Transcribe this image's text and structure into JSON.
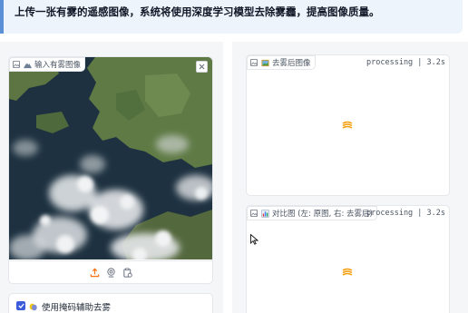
{
  "banner": {
    "text": "上传一张有雾的遥感图像，系统将使用深度学习模型去除雾霾，提高图像质量。"
  },
  "input_panel": {
    "label": "输入有雾图像",
    "label_icon": "mountain-snow-emoji",
    "tools": [
      "upload-icon",
      "webcam-icon",
      "clipboard-icon"
    ]
  },
  "output_panel": {
    "label": "去雾后图像",
    "label_icon": "framed-picture-emoji",
    "status": "processing | 3.2s"
  },
  "compare_panel": {
    "label": "对比图 (左: 原图, 右: 去雾后)",
    "label_icon": "bar-chart-emoji",
    "status": "processing | 3.2s"
  },
  "mask_option": {
    "label": "使用掩码辅助去雾",
    "label_icon": "masks-emoji",
    "checked": true
  },
  "colors": {
    "accent": "#3b5bdb",
    "banner_bg": "#eef4fb",
    "banner_border": "#5b8fd6",
    "spinner": "#f59e0b"
  }
}
